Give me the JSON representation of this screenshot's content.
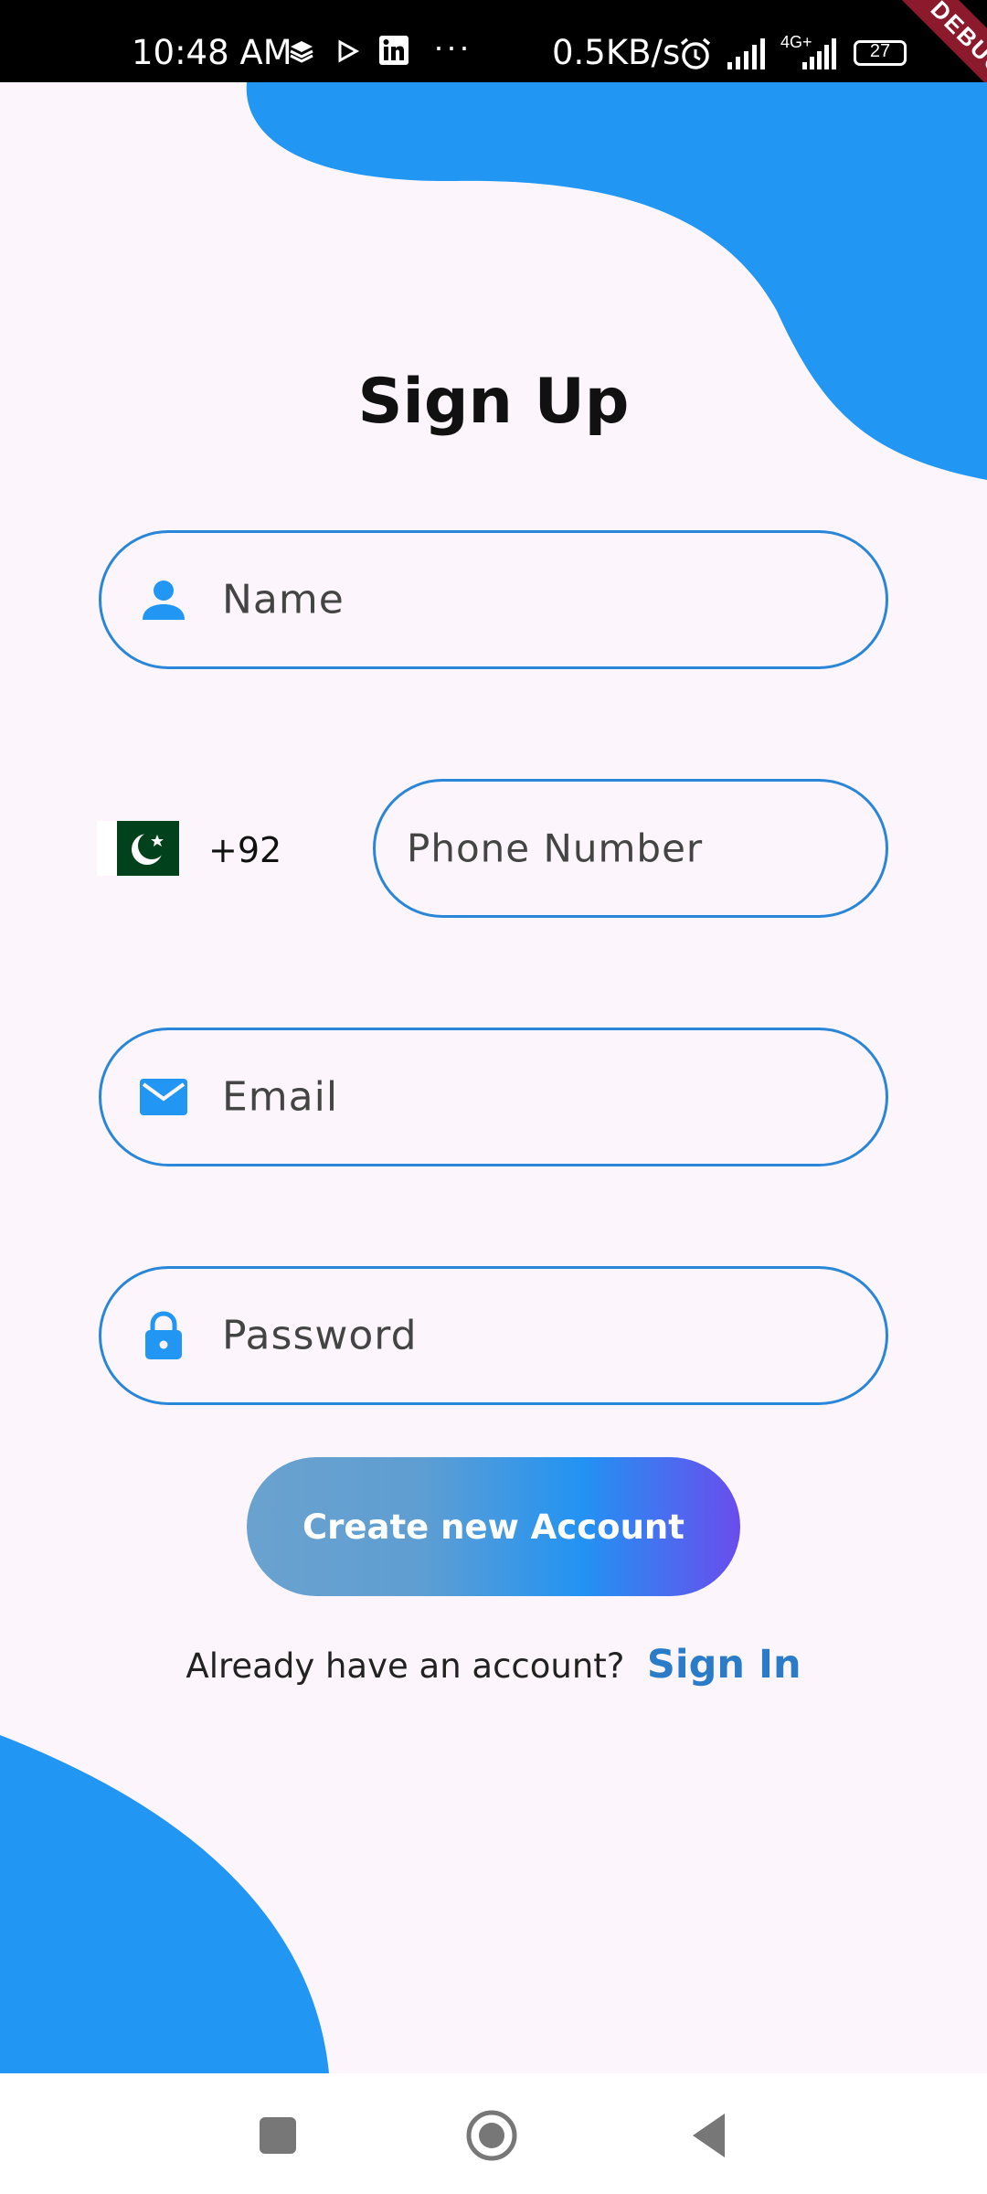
{
  "status_bar": {
    "time": "10:48 AM",
    "net_speed": "0.5KB/s",
    "more": "···",
    "network": "4G+",
    "battery": "27",
    "debug_label": "DEBUG"
  },
  "title": "Sign Up",
  "fields": {
    "name_placeholder": "Name",
    "phone_placeholder": "Phone Number",
    "email_placeholder": "Email",
    "password_placeholder": "Password"
  },
  "country": {
    "dial_code": "+92",
    "flag": "pakistan-flag-icon"
  },
  "create_button_label": "Create new Account",
  "signin": {
    "question": "Already have an account?",
    "link": "Sign In"
  },
  "colors": {
    "accent": "#2196f3",
    "field_border": "#2a86d8",
    "background": "#fcf6fc",
    "link": "#2a7cc9"
  }
}
